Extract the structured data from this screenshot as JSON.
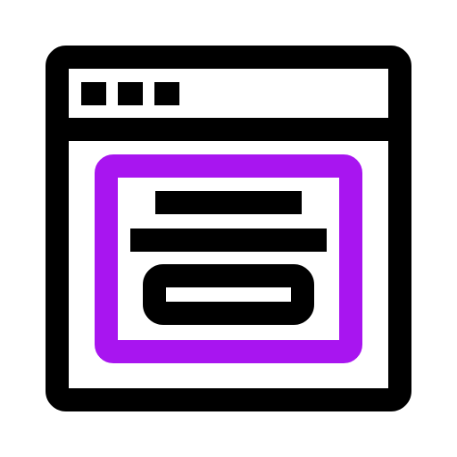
{
  "icon": {
    "name": "browser-window-popup-icon",
    "colors": {
      "stroke": "#000000",
      "accent": "#a815f0",
      "background": "#ffffff"
    }
  },
  "browser_window": {
    "title_bar_dots": [
      "dot-1",
      "dot-2",
      "dot-3"
    ]
  },
  "popup": {
    "text_lines": [
      "line-short",
      "line-long"
    ],
    "button": {
      "inner_bar": "button-bar"
    }
  }
}
